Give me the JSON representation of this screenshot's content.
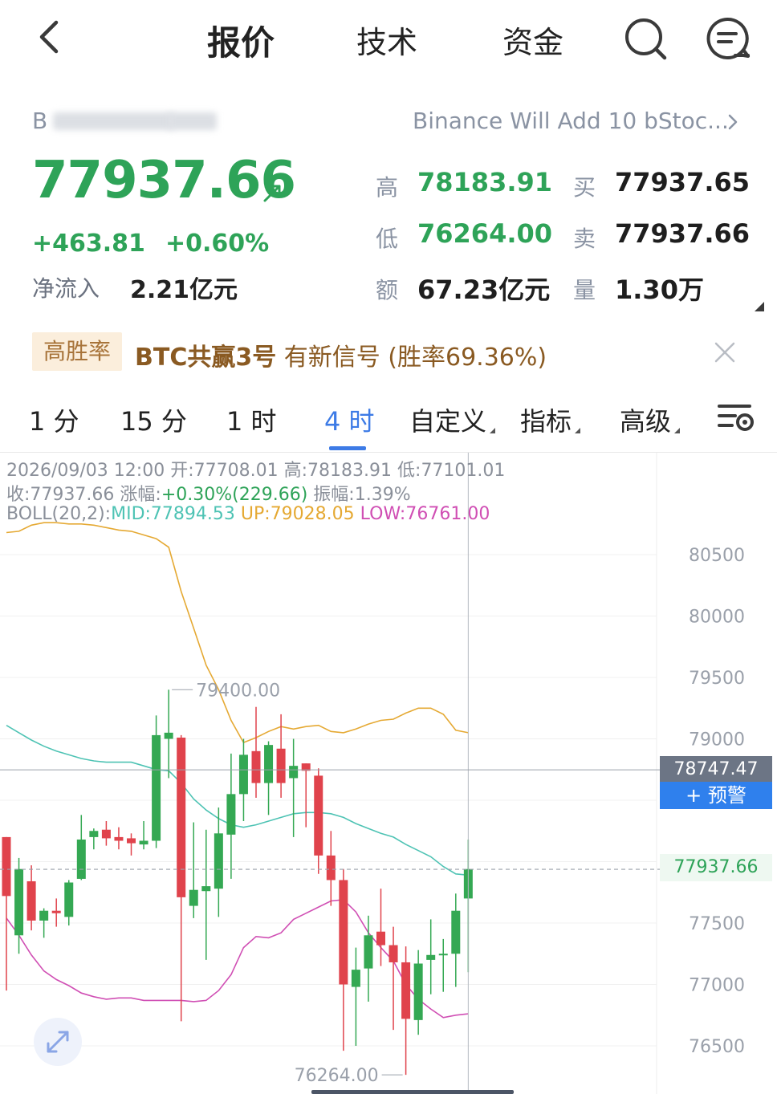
{
  "nav": {
    "tabs": [
      {
        "label": "报价",
        "active": true
      },
      {
        "label": "技术",
        "active": false
      },
      {
        "label": "资金",
        "active": false
      }
    ]
  },
  "quote": {
    "symbol_prefix": "B",
    "news": "Binance Will Add 10 bStoc...",
    "last": "77937.66",
    "change": "+463.81",
    "change_pct": "+0.60%",
    "netflow_label": "净流入",
    "netflow": "2.21亿元",
    "stats": [
      {
        "label": "高",
        "value": "78183.91",
        "tone": "green"
      },
      {
        "label": "买",
        "value": "77937.65",
        "tone": "dark"
      },
      {
        "label": "低",
        "value": "76264.00",
        "tone": "green"
      },
      {
        "label": "卖",
        "value": "77937.66",
        "tone": "dark"
      },
      {
        "label": "额",
        "value": "67.23亿元",
        "tone": "dark"
      },
      {
        "label": "量",
        "value": "1.30万",
        "tone": "dark"
      }
    ]
  },
  "banner": {
    "badge": "高胜率",
    "name": "BTC共赢3号",
    "text": " 有新信号 (胜率69.36%)"
  },
  "intervals": {
    "items": [
      {
        "label": "1 分",
        "active": false,
        "dropdown": false
      },
      {
        "label": "15 分",
        "active": false,
        "dropdown": false
      },
      {
        "label": "1 时",
        "active": false,
        "dropdown": false
      },
      {
        "label": "4 时",
        "active": true,
        "dropdown": false
      },
      {
        "label": "自定义",
        "active": false,
        "dropdown": true
      },
      {
        "label": "指标",
        "active": false,
        "dropdown": true
      },
      {
        "label": "高级",
        "active": false,
        "dropdown": true
      }
    ]
  },
  "chart_info": {
    "line1": {
      "date": "2026/09/03 12:00",
      "open_label": "开:",
      "open": "77708.01",
      "high_label": "高:",
      "high": "78183.91",
      "low_label": "低:",
      "low": "77101.01"
    },
    "line2": {
      "close_label": "收:",
      "close": "77937.66",
      "chg_label": "涨幅:",
      "chg": "+0.30%(229.66)",
      "amp_label": "振幅:",
      "amp": "1.39%"
    },
    "line3": {
      "boll": "BOLL(20,2):",
      "mid": "MID:77894.53",
      "up": "UP:79028.05",
      "low": "LOW:76761.00"
    }
  },
  "price_tags": {
    "crosshair": "78747.47",
    "alert": "+ 预警",
    "last": "77937.66"
  },
  "chart_data": {
    "type": "candlestick",
    "y_axis_ticks": [
      80500,
      80000,
      79500,
      79000,
      78500,
      78000,
      77500,
      77000,
      76500
    ],
    "y_axis_labels": [
      "80500",
      "80000",
      "79500",
      "79000",
      "",
      "",
      "77500",
      "77000",
      "76500"
    ],
    "ylim": [
      76200,
      80800
    ],
    "annotations": {
      "high_label": "79400.00",
      "high": 79400,
      "low_label": "76264.00",
      "low": 76264
    },
    "crosshair_price": 78747.47,
    "last_price": 77937.66,
    "candles": [
      {
        "o": 78200,
        "h": 78200,
        "l": 76950,
        "c": 77720
      },
      {
        "o": 77400,
        "h": 78030,
        "l": 77250,
        "c": 77940
      },
      {
        "o": 77840,
        "h": 77970,
        "l": 77440,
        "c": 77520
      },
      {
        "o": 77520,
        "h": 77620,
        "l": 77380,
        "c": 77600
      },
      {
        "o": 77600,
        "h": 77700,
        "l": 77470,
        "c": 77580
      },
      {
        "o": 77550,
        "h": 77850,
        "l": 77480,
        "c": 77830
      },
      {
        "o": 77860,
        "h": 78380,
        "l": 77850,
        "c": 78180
      },
      {
        "o": 78200,
        "h": 78270,
        "l": 78100,
        "c": 78250
      },
      {
        "o": 78260,
        "h": 78330,
        "l": 78130,
        "c": 78190
      },
      {
        "o": 78200,
        "h": 78280,
        "l": 78100,
        "c": 78170
      },
      {
        "o": 78190,
        "h": 78230,
        "l": 78050,
        "c": 78150
      },
      {
        "o": 78140,
        "h": 78330,
        "l": 78100,
        "c": 78170
      },
      {
        "o": 78170,
        "h": 79190,
        "l": 78110,
        "c": 79030
      },
      {
        "o": 79000,
        "h": 79400,
        "l": 78680,
        "c": 79050
      },
      {
        "o": 79010,
        "h": 79030,
        "l": 76700,
        "c": 77710
      },
      {
        "o": 77640,
        "h": 78320,
        "l": 77540,
        "c": 77770
      },
      {
        "o": 77760,
        "h": 78260,
        "l": 77200,
        "c": 77800
      },
      {
        "o": 77780,
        "h": 78440,
        "l": 77550,
        "c": 78230
      },
      {
        "o": 78220,
        "h": 78880,
        "l": 77860,
        "c": 78550
      },
      {
        "o": 78550,
        "h": 79000,
        "l": 78330,
        "c": 78870
      },
      {
        "o": 78900,
        "h": 79260,
        "l": 78520,
        "c": 78640
      },
      {
        "o": 78640,
        "h": 78980,
        "l": 78380,
        "c": 78950
      },
      {
        "o": 78920,
        "h": 79200,
        "l": 78520,
        "c": 78640
      },
      {
        "o": 78680,
        "h": 79000,
        "l": 78200,
        "c": 78780
      },
      {
        "o": 78800,
        "h": 78800,
        "l": 78280,
        "c": 78740
      },
      {
        "o": 78700,
        "h": 78760,
        "l": 77900,
        "c": 78050
      },
      {
        "o": 78050,
        "h": 78250,
        "l": 77640,
        "c": 77850
      },
      {
        "o": 77850,
        "h": 77940,
        "l": 76460,
        "c": 77000
      },
      {
        "o": 76980,
        "h": 77300,
        "l": 76500,
        "c": 77120
      },
      {
        "o": 77130,
        "h": 77560,
        "l": 76860,
        "c": 77400
      },
      {
        "o": 77430,
        "h": 77780,
        "l": 77150,
        "c": 77320
      },
      {
        "o": 77320,
        "h": 77470,
        "l": 76630,
        "c": 77180
      },
      {
        "o": 77180,
        "h": 77310,
        "l": 76264,
        "c": 76720
      },
      {
        "o": 76710,
        "h": 77280,
        "l": 76590,
        "c": 77170
      },
      {
        "o": 77200,
        "h": 77530,
        "l": 76920,
        "c": 77240
      },
      {
        "o": 77240,
        "h": 77370,
        "l": 76940,
        "c": 77250
      },
      {
        "o": 77250,
        "h": 77740,
        "l": 76980,
        "c": 77600
      },
      {
        "o": 77700,
        "h": 78180,
        "l": 77100,
        "c": 77940
      }
    ],
    "boll": {
      "up": [
        80680,
        80690,
        80740,
        80760,
        80760,
        80750,
        80750,
        80740,
        80720,
        80700,
        80690,
        80660,
        80630,
        80560,
        80200,
        79900,
        79600,
        79400,
        79150,
        78970,
        79010,
        79060,
        79100,
        79080,
        79100,
        79110,
        79060,
        79050,
        79080,
        79120,
        79150,
        79160,
        79210,
        79250,
        79250,
        79200,
        79070,
        79050
      ],
      "mid": [
        79110,
        79050,
        78990,
        78940,
        78900,
        78870,
        78840,
        78820,
        78810,
        78810,
        78810,
        78780,
        78750,
        78740,
        78640,
        78510,
        78420,
        78350,
        78300,
        78280,
        78300,
        78330,
        78360,
        78390,
        78400,
        78400,
        78390,
        78360,
        78310,
        78270,
        78230,
        78200,
        78140,
        78090,
        78040,
        77960,
        77900,
        77890
      ],
      "low": [
        77540,
        77400,
        77240,
        77110,
        77040,
        76990,
        76930,
        76900,
        76880,
        76890,
        76890,
        76870,
        76870,
        76870,
        76870,
        76860,
        76870,
        76950,
        77080,
        77300,
        77390,
        77380,
        77420,
        77530,
        77580,
        77630,
        77680,
        77690,
        77590,
        77420,
        77300,
        77190,
        77000,
        76880,
        76800,
        76730,
        76750,
        76761
      ]
    }
  }
}
